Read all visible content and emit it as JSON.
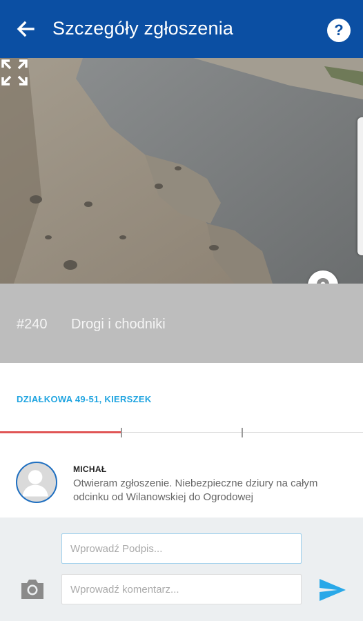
{
  "header": {
    "title": "Szczegóły zgłoszenia",
    "help_label": "?"
  },
  "photo": {
    "alt": "Zdjęcie zgłoszenia"
  },
  "issue": {
    "number": "#240",
    "category": "Drogi i chodniki",
    "address": "DZIAŁKOWA 49-51, KIERSZEK"
  },
  "status_progress": {
    "completed_fraction": 0.333,
    "steps": 3
  },
  "comments": [
    {
      "author": "MICHAŁ",
      "text": "Otwieram zgłoszenie. Niebezpieczne dziury na całym odcinku od Wilanowskiej do Ogrodowej"
    }
  ],
  "composer": {
    "signature_placeholder": "Wprowadź Podpis...",
    "comment_placeholder": "Wprowadź komentarz..."
  },
  "colors": {
    "appbar": "#0b4fa3",
    "accent": "#1fa4e0",
    "progress": "#e05555",
    "send": "#29a8e8"
  },
  "icons": [
    "back-arrow-icon",
    "help-icon",
    "expand-icon",
    "location-pin-icon",
    "avatar-icon",
    "camera-icon",
    "send-icon"
  ]
}
